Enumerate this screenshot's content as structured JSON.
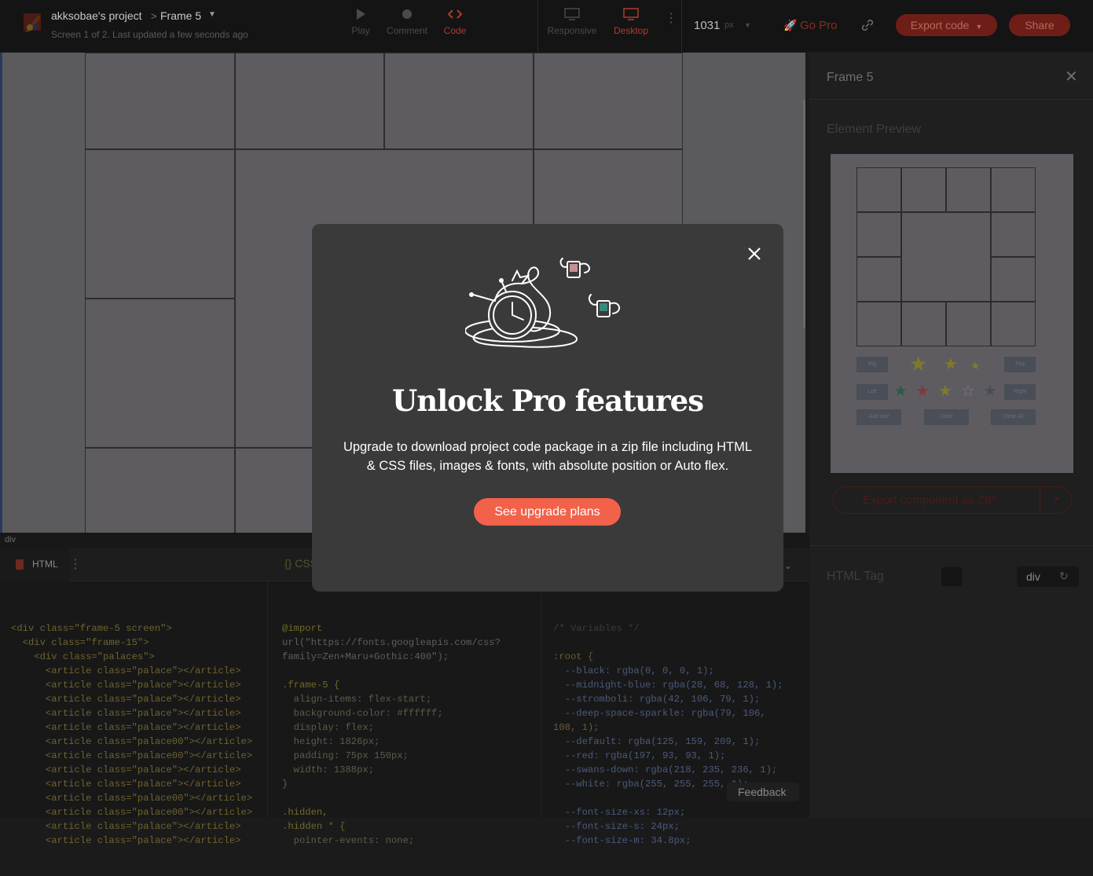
{
  "topbar": {
    "project_name": "akksobae's project",
    "breadcrumb_sep": ">",
    "frame_name": "Frame 5",
    "subtitle": "Screen 1 of 2. Last updated a few seconds ago",
    "tools": [
      {
        "label": "Play",
        "icon": "play-icon"
      },
      {
        "label": "Comment",
        "icon": "comment-icon"
      },
      {
        "label": "Code",
        "icon": "code-icon"
      }
    ],
    "views": [
      {
        "label": "Responsive",
        "icon": "monitor-icon"
      },
      {
        "label": "Desktop",
        "icon": "desktop-icon"
      }
    ],
    "width_value": "1031",
    "width_unit": "px",
    "go_pro": "Go Pro",
    "export_code": "Export code",
    "share": "Share"
  },
  "status_tag": "div",
  "right_panel": {
    "title": "Frame 5",
    "preview_heading": "Element Preview",
    "preview_buttons": [
      "Big",
      "Tiny",
      "Left",
      "Right",
      "Add star",
      "Clear",
      "Clear All"
    ],
    "export_zip": "Export component as ZIP",
    "html_tag_label": "HTML Tag",
    "html_tag_value": "div"
  },
  "code_tabs": {
    "html_label": "HTML",
    "css_label": "{} CSS"
  },
  "html_code": [
    "<div class=\"frame-5 screen\">",
    "  <div class=\"frame-15\">",
    "    <div class=\"palaces\">",
    "      <article class=\"palace\"></article>",
    "      <article class=\"palace\"></article>",
    "      <article class=\"palace\"></article>",
    "      <article class=\"palace\"></article>",
    "      <article class=\"palace\"></article>",
    "      <article class=\"palace00\"></article>",
    "      <article class=\"palace00\"></article>",
    "      <article class=\"palace\"></article>",
    "      <article class=\"palace\"></article>",
    "      <article class=\"palace00\"></article>",
    "      <article class=\"palace00\"></article>",
    "      <article class=\"palace\"></article>",
    "      <article class=\"palace\"></article>"
  ],
  "css_code": [
    "@import",
    "url(\"https://fonts.googleapis.com/css?",
    "family=Zen+Maru+Gothic:400\");",
    "",
    ".frame-5 {",
    "  align-items: flex-start;",
    "  background-color: #ffffff;",
    "  display: flex;",
    "  height: 1826px;",
    "  padding: 75px 150px;",
    "  width: 1388px;",
    "}",
    "",
    ".hidden,",
    ".hidden * {",
    "  pointer-events: none;"
  ],
  "vars_code": [
    "/* Variables */",
    "",
    ":root {",
    "  --black: rgba(0, 0, 0, 1);",
    "  --midnight-blue: rgba(28, 68, 128, 1);",
    "  --stromboli: rgba(42, 106, 79, 1);",
    "  --deep-space-sparkle: rgba(79, 106,",
    "108, 1);",
    "  --default: rgba(125, 159, 209, 1);",
    "  --red: rgba(197, 93, 93, 1);",
    "  --swans-down: rgba(218, 235, 236, 1);",
    "  --white: rgba(255, 255, 255, 1);",
    "",
    "  --font-size-xs: 12px;",
    "  --font-size-s: 24px;",
    "  --font-size-m: 34.8px;"
  ],
  "feedback": "Feedback",
  "modal": {
    "title": "Unlock Pro features",
    "body_line1": "Upgrade to download project code package in a zip file including HTML",
    "body_line2": "& CSS files, images & fonts, with absolute position or Auto flex.",
    "cta": "See upgrade plans",
    "close_icon": "close-icon",
    "illustration": "clock-illustration"
  },
  "colors": {
    "accent": "#f2624a",
    "modal_bg": "#3a3a3a"
  }
}
